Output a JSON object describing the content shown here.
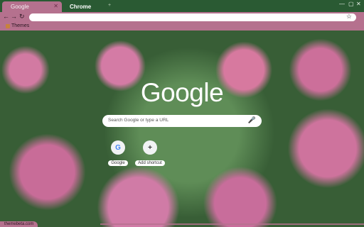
{
  "tabs": [
    {
      "label": "Google",
      "active": true
    },
    {
      "label": "Chrome",
      "active": false
    }
  ],
  "window_controls": {
    "minimize": "—",
    "restore": "▢",
    "close": "✕"
  },
  "toolbar": {
    "back": "←",
    "forward": "→",
    "reload": "↻",
    "bookmark_star": "☆"
  },
  "bookmarks": [
    {
      "label": "Themes",
      "icon": "themes-folder-icon"
    }
  ],
  "newtab": {
    "logo": "Google",
    "search_placeholder": "Search Google or type a URL",
    "shortcuts": [
      {
        "label": "Google",
        "icon_text": "G"
      },
      {
        "label": "Add shortcut",
        "icon_text": "+"
      }
    ]
  },
  "footer": {
    "text": "themebeta.com"
  },
  "colors": {
    "frame": "#2a5a33",
    "tab_active": "#b5718e",
    "toolbar": "#b5718e"
  }
}
